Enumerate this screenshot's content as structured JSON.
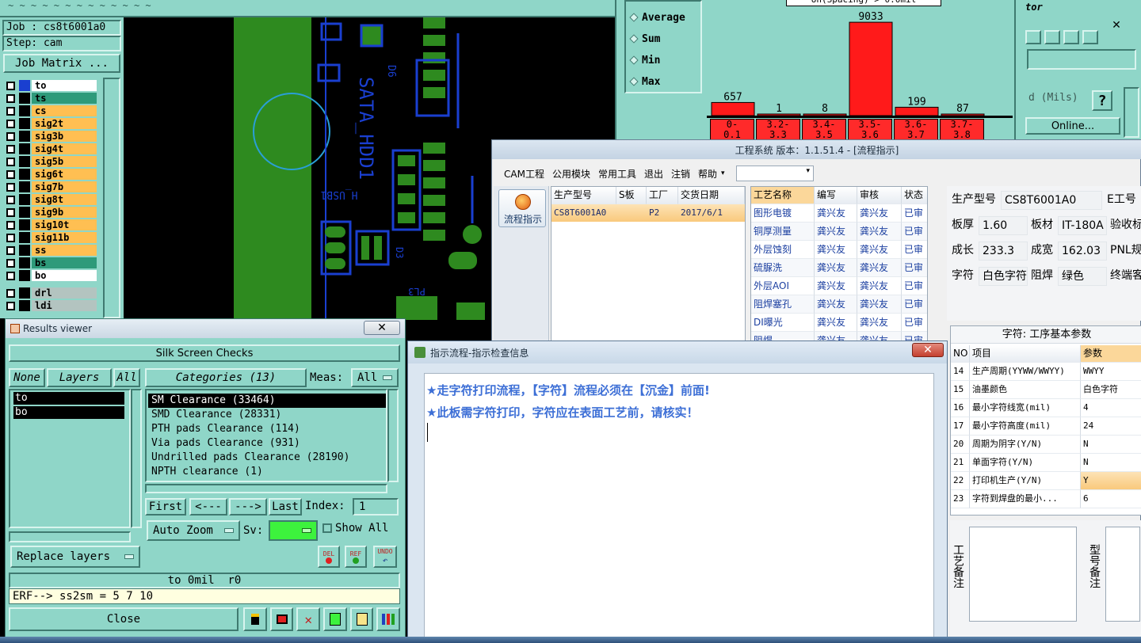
{
  "top_strip": {
    "text": "~ ~ ~ ~ ~ ~ ~ ~ ~ ~ ~ ~ ~"
  },
  "job_panel": {
    "job_label": "Job : cs8t6001a0",
    "step_label": "Step: cam",
    "job_matrix_button": "Job Matrix ...",
    "layers": [
      {
        "name": "to",
        "style": "white"
      },
      {
        "name": "ts",
        "style": "green"
      },
      {
        "name": "cs",
        "style": "orange"
      },
      {
        "name": "sig2t",
        "style": "orange"
      },
      {
        "name": "sig3b",
        "style": "orange"
      },
      {
        "name": "sig4t",
        "style": "orange"
      },
      {
        "name": "sig5b",
        "style": "orange"
      },
      {
        "name": "sig6t",
        "style": "orange"
      },
      {
        "name": "sig7b",
        "style": "orange"
      },
      {
        "name": "sig8t",
        "style": "orange"
      },
      {
        "name": "sig9b",
        "style": "orange"
      },
      {
        "name": "sig10t",
        "style": "orange"
      },
      {
        "name": "sig11b",
        "style": "orange"
      },
      {
        "name": "ss",
        "style": "orange"
      },
      {
        "name": "bs",
        "style": "green"
      },
      {
        "name": "bo",
        "style": "white"
      },
      {
        "name": "drl",
        "style": "grey"
      },
      {
        "name": "ldi",
        "style": "grey"
      }
    ]
  },
  "pcb": {
    "labels": [
      "SATA_HDD1",
      "D6",
      "H_USB1",
      "D3",
      "PL3"
    ]
  },
  "stats_panel": {
    "options": [
      "Average",
      "Sum",
      "Min",
      "Max"
    ]
  },
  "histogram": {
    "title_partial": "on(Spacing) > 0.0mil",
    "chart_data": {
      "type": "bar",
      "categories": [
        "0-0.1",
        "3.2-3.3",
        "3.4-3.5",
        "3.5-3.6",
        "3.6-3.7",
        "3.7-3.8"
      ],
      "values": [
        657,
        1,
        8,
        9033,
        199,
        87
      ],
      "ylim": [
        0,
        9500
      ]
    },
    "bin_labels": [
      "0-\n0.1",
      "3.2-\n3.3",
      "3.4-\n3.5",
      "3.5-\n3.6",
      "3.6-\n3.7",
      "3.7-\n3.8"
    ],
    "colors": {
      "bar": "#ff1a1a",
      "bin_bg": "#ff2a2a"
    }
  },
  "right_motif": {
    "tor_label": "tor",
    "mils_label": "d (Mils)",
    "help_label": "?",
    "online_button": "Online..."
  },
  "results_viewer": {
    "title": "Results viewer",
    "header": "Silk Screen Checks",
    "none_btn": "None",
    "layers_btn": "Layers",
    "all_btn": "All",
    "categories_btn": "Categories (13)",
    "meas_label": "Meas:",
    "meas_value": "All",
    "selected_layers": [
      "to",
      "bo"
    ],
    "categories": [
      "SM Clearance (33464)",
      "SMD Clearance (28331)",
      "PTH pads Clearance (114)",
      "Via pads Clearance (931)",
      "Undrilled pads Clearance (28190)",
      "NPTH clearance (1)"
    ],
    "first_btn": "First",
    "prev_btn": "<---",
    "next_btn": "--->",
    "last_btn": "Last",
    "index_label": "Index:",
    "index_value": "1",
    "auto_zoom_btn": "Auto Zoom",
    "sv_label": "Sv:",
    "show_all_label": "Show All",
    "replace_layers_btn": "Replace layers",
    "del_label": "DEL",
    "ref_label": "REF",
    "undo_label": "UNDO",
    "status_line": "to 0mil  r0",
    "erf_line": "ERF--> ss2sm = 5 7 10",
    "close_btn": "Close"
  },
  "eng_window": {
    "title": "工程系统   版本：1.1.51.4 - [流程指示]",
    "menu": [
      "CAM工程",
      "公用模块",
      "常用工具",
      "退出",
      "注销",
      "帮助"
    ],
    "side_button": "流程指示",
    "orders_headers": [
      "生产型号",
      "S板",
      "工厂",
      "交货日期"
    ],
    "orders_row": [
      "CS8T6001A0",
      "",
      "P2",
      "2017/6/1"
    ],
    "process_headers": [
      "工艺名称",
      "编写",
      "审核",
      "状态"
    ],
    "process_rows": [
      [
        "图形电镀",
        "龚兴友",
        "龚兴友",
        "已审"
      ],
      [
        "铜厚测量",
        "龚兴友",
        "龚兴友",
        "已审"
      ],
      [
        "外层蚀刻",
        "龚兴友",
        "龚兴友",
        "已审"
      ],
      [
        "硫脲洗",
        "龚兴友",
        "龚兴友",
        "已审"
      ],
      [
        "外层AOI",
        "龚兴友",
        "龚兴友",
        "已审"
      ],
      [
        "阻焊塞孔",
        "龚兴友",
        "龚兴友",
        "已审"
      ],
      [
        "DI曝光",
        "龚兴友",
        "龚兴友",
        "已审"
      ],
      [
        "阻焊",
        "龚兴友",
        "龚兴友",
        "已审"
      ]
    ],
    "info": {
      "model_label": "生产型号",
      "model_value": "CS8T6001A0",
      "e_label": "E工号",
      "thick_label": "板厚",
      "thick_value": "1.60",
      "mat_label": "板材",
      "mat_value": "IT-180A",
      "check_label": "验收标",
      "len_label": "成长",
      "len_value": "233.3",
      "wid_label": "成宽",
      "wid_value": "162.03",
      "pnl_label": "PNL规",
      "char_label": "字符",
      "char_value": "白色字符",
      "mask_label": "阻焊",
      "mask_value": "绿色",
      "cust_label": "终端客"
    },
    "params_title": "字符: 工序基本参数",
    "params_headers": [
      "NO",
      "项目",
      "参数"
    ],
    "params_rows": [
      [
        "14",
        "生产周期(YYWW/WWYY)",
        "WWYY"
      ],
      [
        "15",
        "油墨颜色",
        "白色字符"
      ],
      [
        "16",
        "最小字符线宽(mil)",
        "4"
      ],
      [
        "17",
        "最小字符高度(mil)",
        "24"
      ],
      [
        "20",
        "周期为阴字(Y/N)",
        "N"
      ],
      [
        "21",
        "单面字符(Y/N)",
        "N"
      ],
      [
        "22",
        "打印机生产(Y/N)",
        "Y"
      ],
      [
        "23",
        "字符到焊盘的最小...",
        "6"
      ]
    ],
    "notes_left": "工艺备注",
    "notes_right": "型号备注"
  },
  "info_dialog": {
    "title": "指示流程-指示检查信息",
    "lines": [
      "★走字符打印流程，【字符】流程必须在【沉金】前面!",
      "★此板需字符打印，字符应在表面工艺前，请核实！"
    ],
    "text_color": "#3d6fd6"
  }
}
